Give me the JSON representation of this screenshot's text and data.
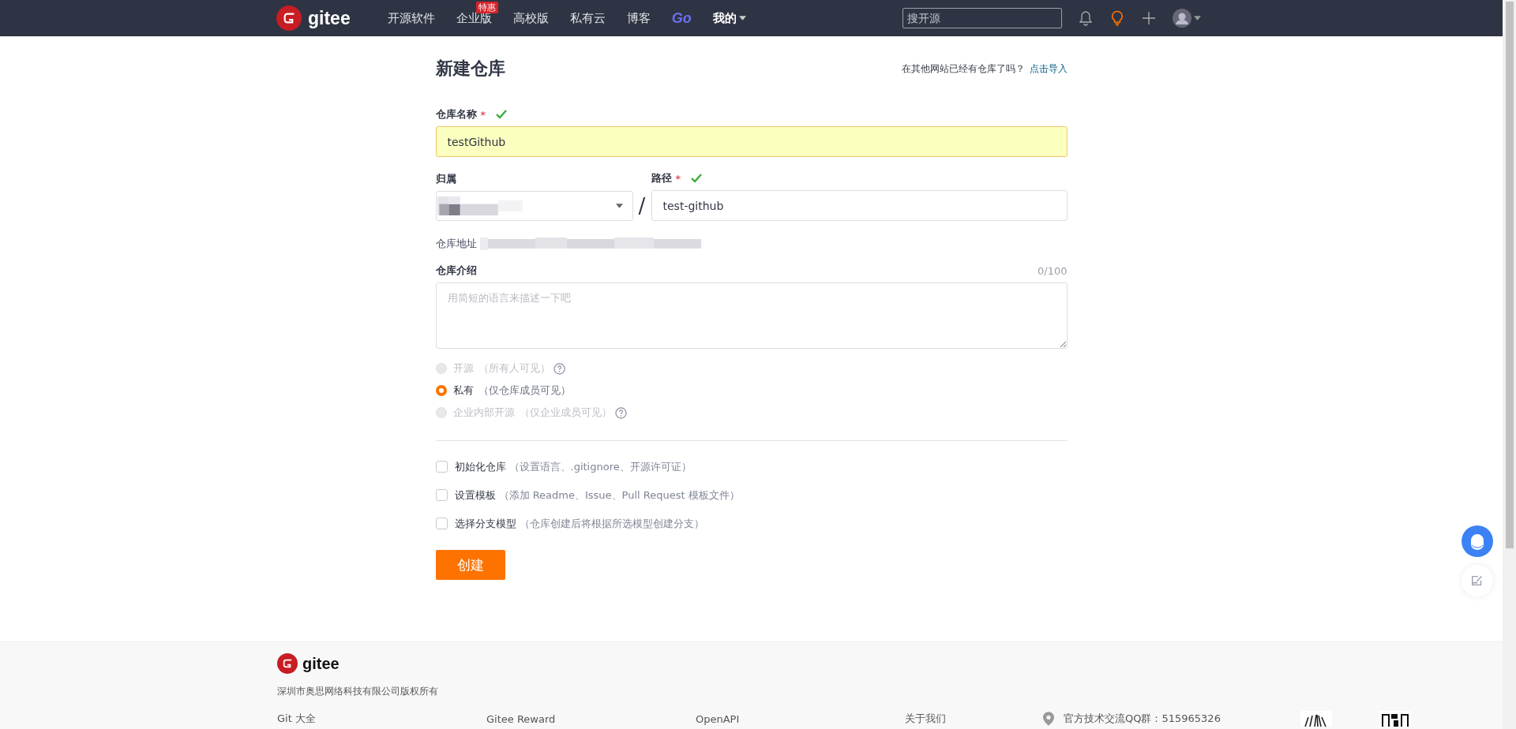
{
  "nav": {
    "logo": "gitee",
    "items": [
      {
        "label": "开源软件",
        "kind": "text"
      },
      {
        "label": "企业版",
        "kind": "text",
        "badge": "特惠"
      },
      {
        "label": "高校版",
        "kind": "text"
      },
      {
        "label": "私有云",
        "kind": "text"
      },
      {
        "label": "博客",
        "kind": "text"
      },
      {
        "label": "Go",
        "kind": "go"
      },
      {
        "label": "我的",
        "kind": "dropdown"
      }
    ],
    "search": {
      "placeholder": "搜开源"
    }
  },
  "form": {
    "title": "新建仓库",
    "import_prompt": "在其他网站已经有仓库了吗？",
    "import_link": "点击导入",
    "name_field": {
      "label": "仓库名称",
      "required_mark": "*",
      "valid": true,
      "value": "testGithub"
    },
    "owner": {
      "label": "归属"
    },
    "separator": "/",
    "path_field": {
      "label": "路径",
      "required_mark": "*",
      "valid": true,
      "value": "test-github"
    },
    "address_label": "仓库地址",
    "description": {
      "label": "仓库介绍",
      "counter": "0/100",
      "placeholder": "用简短的语言来描述一下吧"
    },
    "visibility": [
      {
        "label": "开源",
        "note": "（所有人可见）",
        "selected": false,
        "disabled": true,
        "help": true
      },
      {
        "label": "私有",
        "note": "（仅仓库成员可见）",
        "selected": true,
        "disabled": false,
        "help": false
      },
      {
        "label": "企业内部开源",
        "note": "（仅企业成员可见）",
        "selected": false,
        "disabled": true,
        "help": true
      }
    ],
    "options": [
      {
        "label": "初始化仓库",
        "note": "（设置语言、.gitignore、开源许可证）",
        "checked": false
      },
      {
        "label": "设置模板",
        "note": "（添加 Readme、Issue、Pull Request 模板文件）",
        "checked": false
      },
      {
        "label": "选择分支模型",
        "note": "（仓库创建后将根据所选模型创建分支）",
        "checked": false
      }
    ],
    "submit": "创建"
  },
  "footer": {
    "logo": "gitee",
    "copyright": "深圳市奥思网络科技有限公司版权所有",
    "links": [
      "Git 大全",
      "Gitee Reward",
      "OpenAPI",
      "关于我们"
    ],
    "qq": "官方技术交流QQ群：515965326"
  }
}
